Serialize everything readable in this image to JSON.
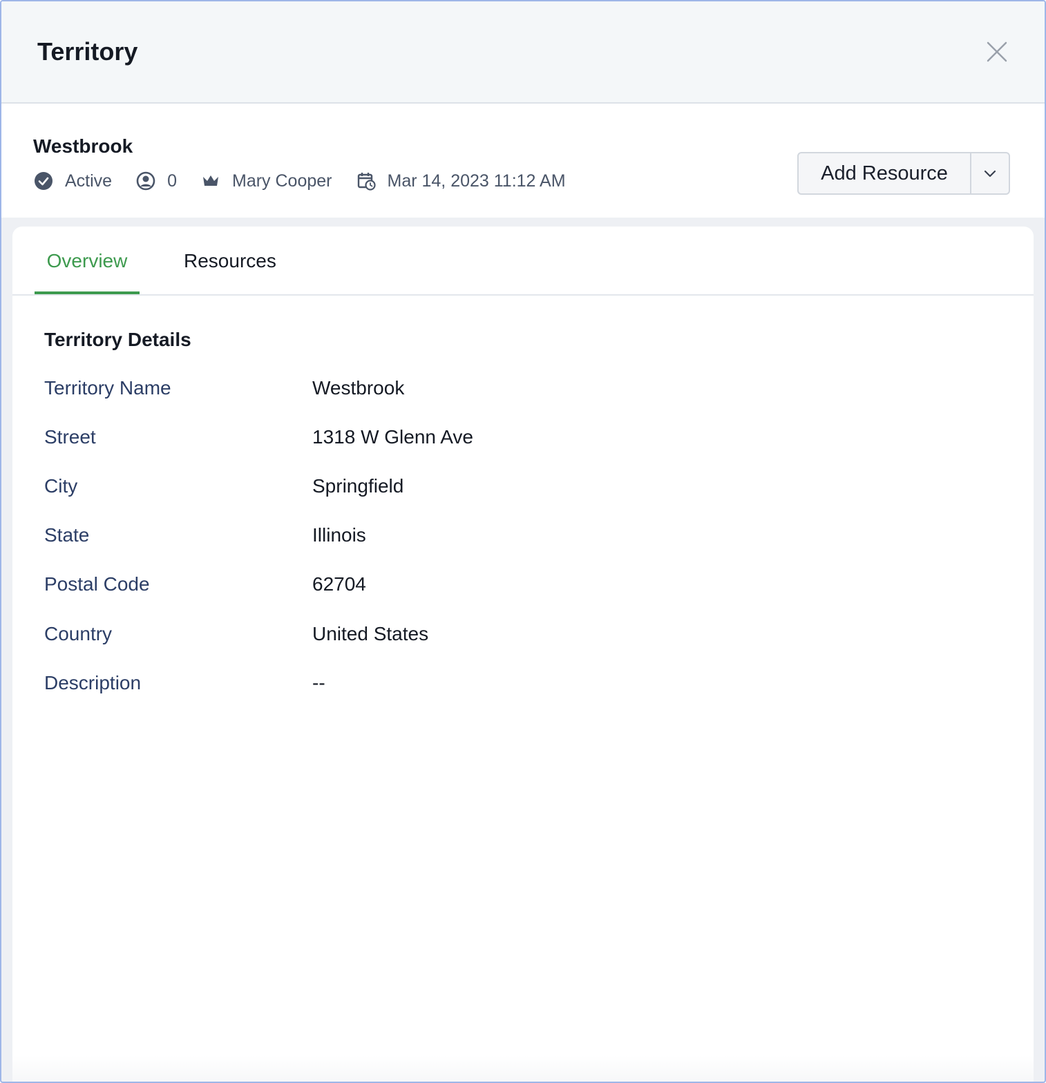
{
  "header": {
    "title": "Territory"
  },
  "summary": {
    "name": "Westbrook",
    "status": "Active",
    "user_count": "0",
    "owner": "Mary Cooper",
    "created": "Mar 14, 2023 11:12 AM"
  },
  "actions": {
    "add_resource_label": "Add Resource"
  },
  "tabs": [
    {
      "label": "Overview",
      "active": true
    },
    {
      "label": "Resources",
      "active": false
    }
  ],
  "details": {
    "title": "Territory Details",
    "fields": [
      {
        "label": "Territory Name",
        "value": "Westbrook"
      },
      {
        "label": "Street",
        "value": "1318 W Glenn Ave"
      },
      {
        "label": "City",
        "value": "Springfield"
      },
      {
        "label": "State",
        "value": "Illinois"
      },
      {
        "label": "Postal Code",
        "value": "62704"
      },
      {
        "label": "Country",
        "value": "United States"
      },
      {
        "label": "Description",
        "value": "--"
      }
    ]
  },
  "icons": {
    "close": "close-icon",
    "status": "check-circle-icon",
    "users": "user-circle-icon",
    "owner": "crown-icon",
    "created": "calendar-clock-icon",
    "dropdown": "chevron-down-icon"
  },
  "colors": {
    "accent": "#3d9a4e",
    "label": "#2c3e66",
    "meta": "#4a5568"
  }
}
